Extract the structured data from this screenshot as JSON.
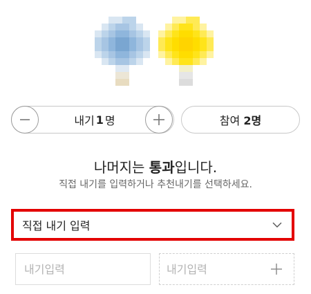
{
  "icons": {
    "left": "popsicle-blue-icon",
    "right": "popsicle-yellow-icon"
  },
  "stepper": {
    "prefix": "내기",
    "count": "1",
    "unit": "명",
    "minus_icon": "minus-icon",
    "plus_icon": "plus-icon"
  },
  "join": {
    "prefix": "참여",
    "count": "2명"
  },
  "message": {
    "title_prefix": "나머지는",
    "title_bold": "통과",
    "title_suffix": "입니다.",
    "subtitle": "직접 내기를 입력하거나 추천내기를 선택하세요."
  },
  "select": {
    "value": "직접 내기 입력",
    "icon": "chevron-down-icon"
  },
  "inputs": {
    "first_placeholder": "내기입력",
    "second_placeholder": "내기입력",
    "add_icon": "plus-icon"
  },
  "colors": {
    "highlight_border": "#e30000",
    "blue_icon": "#a9c8e6",
    "yellow_icon": "#ffe400"
  }
}
